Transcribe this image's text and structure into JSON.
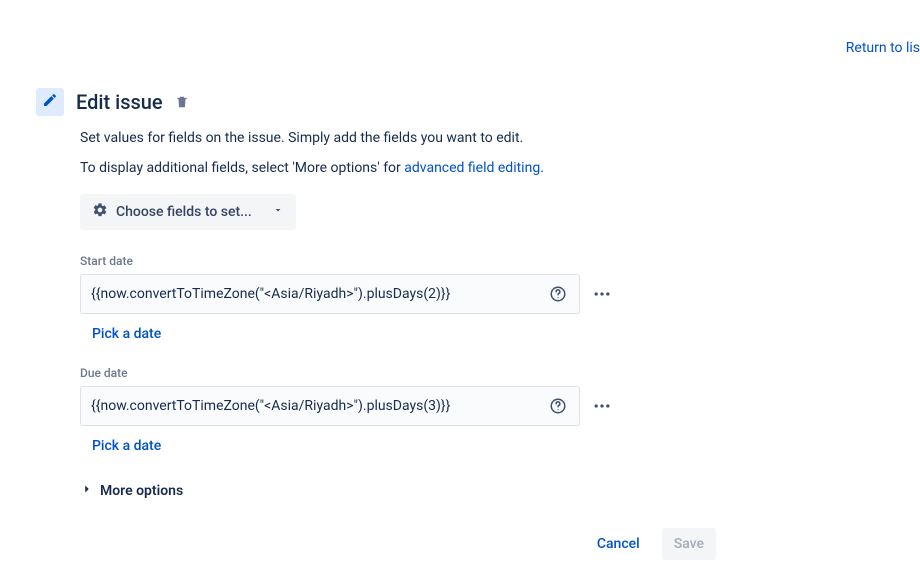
{
  "returnLink": "Return to lis",
  "title": "Edit issue",
  "description1": "Set values for fields on the issue. Simply add the fields you want to edit.",
  "description2_prefix": "To display additional fields, select 'More options' for ",
  "description2_link": "advanced field editing",
  "description2_suffix": ".",
  "chooseFieldsLabel": "Choose fields to set...",
  "fields": {
    "startDate": {
      "label": "Start date",
      "value": "{{now.convertToTimeZone(\"<Asia/Riyadh>\").plusDays(2)}}",
      "pickLink": "Pick a date"
    },
    "dueDate": {
      "label": "Due date",
      "value": "{{now.convertToTimeZone(\"<Asia/Riyadh>\").plusDays(3)}}",
      "pickLink": "Pick a date"
    }
  },
  "moreOptionsLabel": "More options",
  "buttons": {
    "cancel": "Cancel",
    "save": "Save"
  }
}
